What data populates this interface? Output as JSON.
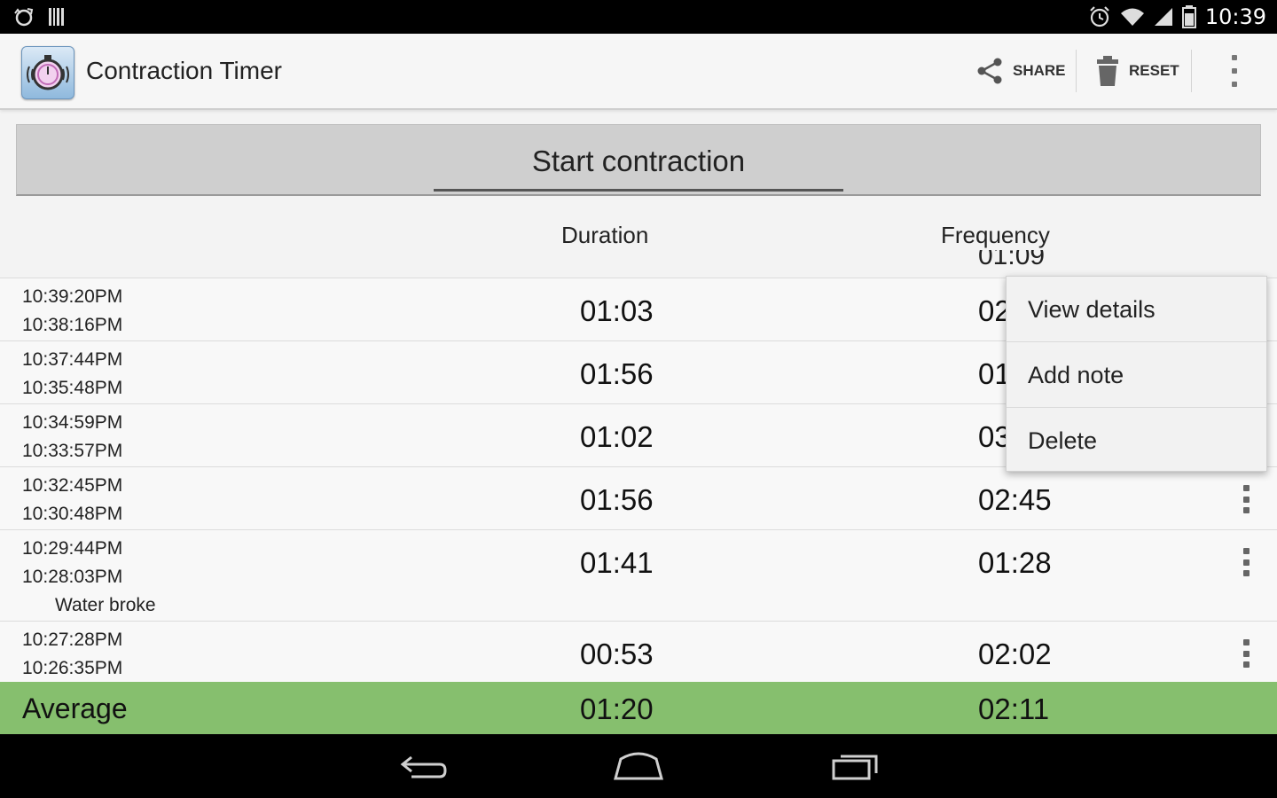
{
  "status_bar": {
    "time": "10:39",
    "left_icons": [
      "sync-icon",
      "barcode-icon"
    ],
    "right_icons": [
      "alarm-icon",
      "wifi-icon",
      "signal-icon",
      "battery-icon"
    ]
  },
  "action_bar": {
    "title": "Contraction Timer",
    "share_label": "SHARE",
    "reset_label": "RESET"
  },
  "start_button": {
    "label": "Start contraction"
  },
  "table": {
    "headers": {
      "duration": "Duration",
      "frequency": "Frequency"
    },
    "partial_top_frequency": "01:09",
    "rows": [
      {
        "end": "10:39:20PM",
        "start": "10:38:16PM",
        "duration": "01:03",
        "frequency": "02"
      },
      {
        "end": "10:37:44PM",
        "start": "10:35:48PM",
        "duration": "01:56",
        "frequency": "01"
      },
      {
        "end": "10:34:59PM",
        "start": "10:33:57PM",
        "duration": "01:02",
        "frequency": "03"
      },
      {
        "end": "10:32:45PM",
        "start": "10:30:48PM",
        "duration": "01:56",
        "frequency": "02:45"
      },
      {
        "end": "10:29:44PM",
        "start": "10:28:03PM",
        "duration": "01:41",
        "frequency": "01:28",
        "note": "Water broke"
      },
      {
        "end": "10:27:28PM",
        "start": "10:26:35PM",
        "duration": "00:53",
        "frequency": "02:02"
      }
    ],
    "average": {
      "label": "Average",
      "duration": "01:20",
      "frequency": "02:11"
    }
  },
  "popup_menu": {
    "items": [
      "View details",
      "Add note",
      "Delete"
    ]
  },
  "colors": {
    "average_bar": "#86bf6e",
    "status_bar": "#000000"
  }
}
